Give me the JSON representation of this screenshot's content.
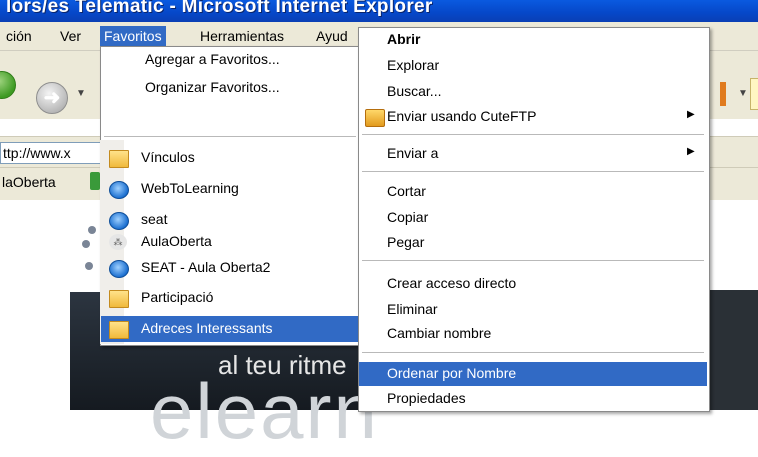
{
  "window": {
    "title": "lors/es Telematic - Microsoft Internet Explorer"
  },
  "menubar": {
    "items": [
      "ción",
      "Ver",
      "Favoritos",
      "Herramientas",
      "Ayud"
    ]
  },
  "address": {
    "value": "ttp://www.x"
  },
  "links": {
    "item": "laOberta"
  },
  "favorites_menu": {
    "top_items": [
      "Agregar a Favoritos...",
      "Organizar Favoritos..."
    ],
    "items": [
      {
        "label": "Vínculos",
        "icon": "folder-icon"
      },
      {
        "label": "WebToLearning",
        "icon": "ie-icon"
      },
      {
        "label": "seat",
        "icon": "ie-icon"
      },
      {
        "label": "AulaOberta",
        "icon": "link-icon"
      },
      {
        "label": "SEAT - Aula Oberta2",
        "icon": "ie-icon"
      },
      {
        "label": "Participació",
        "icon": "folder-icon"
      },
      {
        "label": "Adreces Interessants",
        "icon": "folder-icon",
        "highlighted": true
      }
    ]
  },
  "context_menu": {
    "items": {
      "abrir": "Abrir",
      "explorar": "Explorar",
      "buscar": "Buscar...",
      "enviar_cuteftp": "Enviar usando CuteFTP",
      "enviar_a": "Enviar a",
      "cortar": "Cortar",
      "copiar": "Copiar",
      "pegar": "Pegar",
      "crear_acceso": "Crear acceso directo",
      "eliminar": "Eliminar",
      "cambiar_nombre": "Cambiar nombre",
      "ordenar": "Ordenar por Nombre",
      "propiedades": "Propiedades"
    }
  },
  "page": {
    "banner_line1": "al teu ritme",
    "banner_line2": "elearn"
  },
  "colors": {
    "highlight": "#316ac5",
    "titlebar": "#0a5ae0",
    "menu_bg": "#ece9d8"
  }
}
